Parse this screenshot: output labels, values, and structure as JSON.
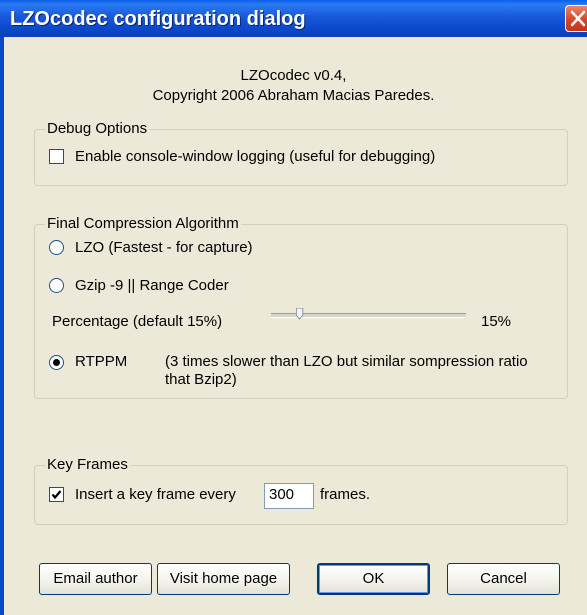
{
  "window": {
    "title": "LZOcodec configuration dialog"
  },
  "about": {
    "line1": "LZOcodec v0.4,",
    "line2": "Copyright 2006 Abraham Macias Paredes."
  },
  "debug": {
    "group_label": "Debug Options",
    "checkbox_label": "Enable console-window logging (useful for debugging)",
    "checked": false
  },
  "compression": {
    "group_label": "Final Compression Algorithm",
    "option_lzo": "LZO (Fastest - for capture)",
    "option_gzip": "Gzip -9 || Range Coder",
    "percentage_label": "Percentage (default 15%)",
    "percentage_value": "15%",
    "slider_fraction": 0.15,
    "option_rtppm": "RTPPM",
    "rtppm_desc_line1": "(3 times slower than LZO but similar sompression ratio",
    "rtppm_desc_line2": "that Bzip2)",
    "selected": "RTPPM"
  },
  "keyframes": {
    "group_label": "Key Frames",
    "checkbox_label": "Insert a key frame every",
    "value": "300",
    "suffix": "frames.",
    "checked": true
  },
  "buttons": {
    "email": "Email author",
    "home": "Visit home page",
    "ok": "OK",
    "cancel": "Cancel"
  },
  "colors": {
    "titlebar": "#0A5FE8",
    "dialog_bg": "#ECE9D8",
    "close_button": "#D6472A"
  }
}
